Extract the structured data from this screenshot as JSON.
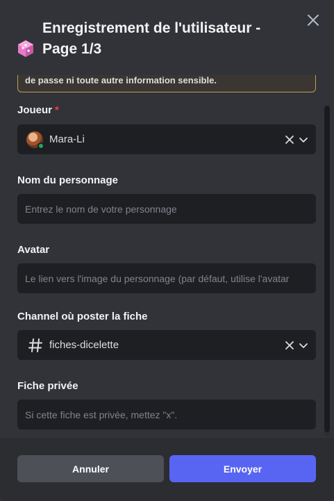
{
  "header": {
    "title": "Enregistrement de l'utilisateur - Page 1/3",
    "icon": "dice-icon"
  },
  "warning": {
    "text": "de passe ni toute autre information sensible."
  },
  "fields": {
    "player": {
      "label": "Joueur",
      "required_mark": "*",
      "value": "Mara-Li"
    },
    "character_name": {
      "label": "Nom du personnage",
      "placeholder": "Entrez le nom de votre personnage",
      "value": ""
    },
    "avatar": {
      "label": "Avatar",
      "placeholder": "Le lien vers l'image du personnage (par défaut, utilise l'avatar",
      "value": ""
    },
    "channel": {
      "label": "Channel où poster la fiche",
      "value": "fiches-dicelette"
    },
    "private": {
      "label": "Fiche privée",
      "placeholder": "Si cette fiche est privée, mettez \"x\".",
      "value": ""
    }
  },
  "footer": {
    "cancel_label": "Annuler",
    "submit_label": "Envoyer"
  },
  "colors": {
    "accent": "#5865f2",
    "background": "#313338",
    "input_bg": "#1e1f22",
    "warning_border": "#c29c5c",
    "required": "#f23f43",
    "online": "#23a55a"
  }
}
